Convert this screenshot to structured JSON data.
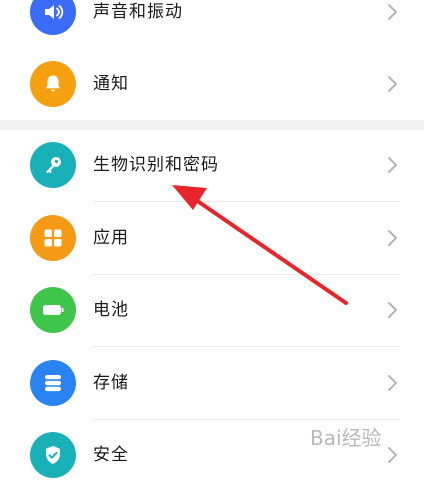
{
  "settings": {
    "items": [
      {
        "label": "声音和振动",
        "icon": "speaker-icon",
        "color": "#3b6cf6"
      },
      {
        "label": "通知",
        "icon": "bell-icon",
        "color": "#f5a010"
      },
      {
        "label": "生物识别和密码",
        "icon": "key-icon",
        "color": "#1ab0b7"
      },
      {
        "label": "应用",
        "icon": "apps-grid-icon",
        "color": "#f59a14"
      },
      {
        "label": "电池",
        "icon": "battery-icon",
        "color": "#3fc54a"
      },
      {
        "label": "存储",
        "icon": "storage-icon",
        "color": "#2a83f2"
      },
      {
        "label": "安全",
        "icon": "shield-check-icon",
        "color": "#1ab0b7"
      }
    ]
  },
  "annotation": {
    "arrow_color": "#e8252a",
    "points_to": "生物识别和密码"
  },
  "watermark": {
    "text": "Bai经验"
  }
}
